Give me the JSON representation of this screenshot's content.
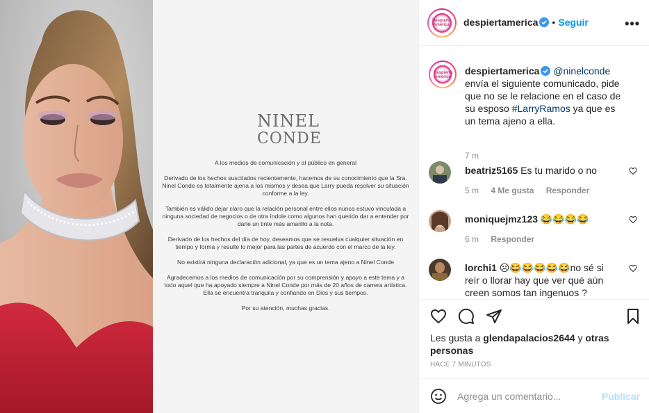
{
  "statement": {
    "logo_line1": "NINEL",
    "logo_line2": "CONDE",
    "p1": "A los medios de comunicación y al público en general",
    "p2": "Derivado de los hechos suscitados recientemente, hacemos de su conocimiento que la Sra. Ninel Conde es totalmente ajena a los mismos y desea que Larry pueda resolver su situación conforme a la ley.",
    "p3": "También es válido dejar claro que la relación personal entre ellos nunca estuvo vinculada a ninguna sociedad de negocios o de otra índole como algunos han querido dar a entender por darle un tinte más amarillo a la nota.",
    "p4": "Derivado de los hechos del día de hoy, deseamos que se resuelva cualquier situación en tiempo y forma y resulte lo mejor para las partes de acuerdo con el marco de la ley.",
    "p5": "No existirá ninguna declaración adicional, ya que es un tema ajeno a Ninel Conde",
    "p6": "Agradecemos a los medios de comunicación por su comprensión y apoyo a este tema y a todo aquel que ha apoyado siempre a Ninel Conde por más de 20 años de carrera artística. Ella se encuentra tranquila y confiando en Dios y sus tiempos.",
    "p7": "Por su atención, muchas gracias."
  },
  "header": {
    "username": "despiertamerica",
    "separator": "•",
    "follow_label": "Seguir",
    "more_label": "•••"
  },
  "caption": {
    "username": "despiertamerica",
    "mention": "@ninelconde",
    "text_part1": "envía el siguiente comunicado, pide que no se le relacione en el caso de su esposo",
    "hashtag": "#LarryRamos",
    "text_part2": "ya que es un tema ajeno a ella.",
    "time": "7 m"
  },
  "comments": [
    {
      "username": "beatriz5165",
      "text": "Es tu marido o no",
      "time": "5 m",
      "likes": "4 Me gusta",
      "reply": "Responder"
    },
    {
      "username": "moniquejmz123",
      "text": "😂😂😂😂",
      "time": "6 m",
      "reply": "Responder"
    },
    {
      "username": "lorchi1",
      "emoji": "☹😂😂😂😂😂",
      "text": "no sé si reír o llorar hay que ver qué aún creen somos tan ingenuos ?"
    }
  ],
  "likes": {
    "prefix": "Les gusta a",
    "user": "glendapalacios2644",
    "and": "y",
    "others": "otras personas"
  },
  "time_ago": "HACE 7 MINUTOS",
  "add_comment": {
    "placeholder": "Agrega un comentario...",
    "publish_label": "Publicar"
  },
  "avatar_text": "Despierta America",
  "colors": {
    "accent": "#0095f6",
    "link": "#00376b",
    "muted": "#8e8e8e",
    "publish_disabled": "#b2dffc"
  }
}
